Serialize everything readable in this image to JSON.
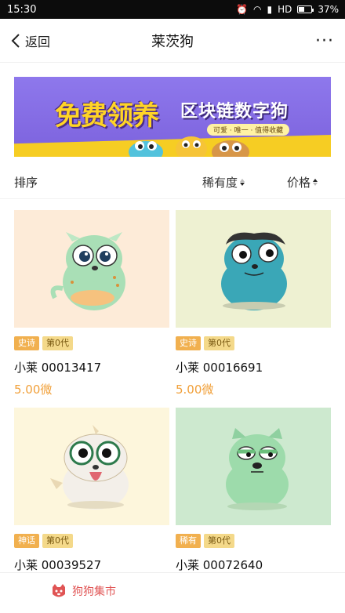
{
  "status_bar": {
    "time": "15:30",
    "network": "HD",
    "battery": "37%"
  },
  "nav": {
    "back_label": "返回",
    "title": "莱茨狗",
    "more_label": "···"
  },
  "banner": {
    "headline": "免费领养",
    "subtitle": "区块链数字狗",
    "tagline": "可爱 · 唯一 · 值得收藏"
  },
  "sort": {
    "label": "排序",
    "options": [
      {
        "label": "稀有度",
        "direction": "down"
      },
      {
        "label": "价格",
        "direction": "up"
      }
    ]
  },
  "items": [
    {
      "rarity": "史诗",
      "generation": "第0代",
      "name": "小莱 00013417",
      "price": "5.00微",
      "bg": "#fdebd8",
      "dog": "#a9dfb6"
    },
    {
      "rarity": "史诗",
      "generation": "第0代",
      "name": "小莱 00016691",
      "price": "5.00微",
      "bg": "#eef1d2",
      "dog": "#3aa7b7"
    },
    {
      "rarity": "神话",
      "generation": "第0代",
      "name": "小莱 00039527",
      "price": "",
      "bg": "#fdf6dc",
      "dog": "#f3efe9"
    },
    {
      "rarity": "稀有",
      "generation": "第0代",
      "name": "小莱 00072640",
      "price": "",
      "bg": "#cde9cf",
      "dog": "#9ddbab"
    }
  ],
  "bottom_tab": {
    "label": "狗狗集市",
    "color": "#e05454"
  },
  "colors": {
    "accent_price": "#f1a03a",
    "tag_rarity": "#f1b04f",
    "tag_generation": "#f4d98a"
  }
}
